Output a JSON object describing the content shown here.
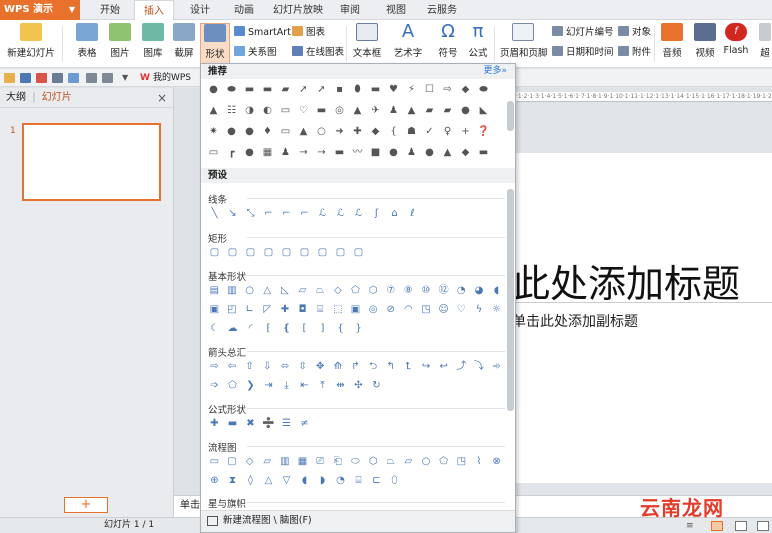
{
  "app": {
    "logo": "WPS 演示",
    "accent": "#e8722c"
  },
  "menu_tabs": [
    "开始",
    "插入",
    "设计",
    "动画",
    "幻灯片放映",
    "审阅",
    "视图",
    "云服务"
  ],
  "active_tab": "插入",
  "ribbon": {
    "new_slide": "新建幻灯片",
    "table": "表格",
    "picture": "图片",
    "gallery": "图库",
    "screenshot": "截屏",
    "shape": "形状",
    "smartart": "SmartArt",
    "chart": "图表",
    "relation": "关系图",
    "online_chart": "在线图表",
    "textbox": "文本框",
    "wordart": "艺术字",
    "symbol": "符号",
    "formula": "公式",
    "header_footer": "页眉和页脚",
    "slide_number": "幻灯片编号",
    "object": "对象",
    "datetime": "日期和时间",
    "attachment": "附件",
    "audio": "音频",
    "video": "视频",
    "flash": "Flash",
    "more": "超"
  },
  "qat": {
    "my_wps": "我的WPS"
  },
  "left_panel": {
    "tab_outline": "大纲",
    "tab_slides": "幻灯片",
    "close": "×",
    "slide_number": "1",
    "add": "+"
  },
  "slide": {
    "title": "此处添加标题",
    "subtitle": "单击此处添加副标题"
  },
  "notes_placeholder": "单击",
  "status": {
    "slide_count": "幻灯片 1 / 1"
  },
  "watermark": "云南龙网",
  "shape_gallery": {
    "recommended": "推荐",
    "more": "更多»",
    "preset": "预设",
    "sections": [
      "线条",
      "矩形",
      "基本形状",
      "箭头总汇",
      "公式形状",
      "流程图",
      "星与旗帜"
    ],
    "footer": "新建流程图 \\ 脑图(F)"
  }
}
